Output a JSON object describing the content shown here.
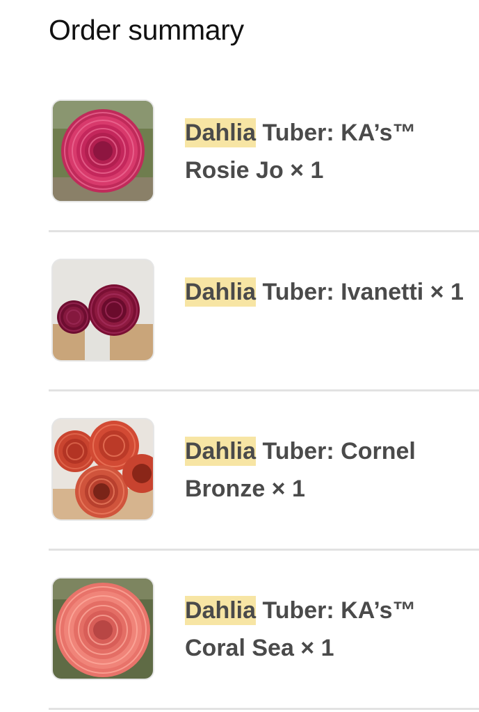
{
  "header": {
    "title": "Order summary"
  },
  "highlight": {
    "term": "Dahlia",
    "color": "#f7e5a4"
  },
  "items": [
    {
      "highlight": "Dahlia",
      "rest": " Tuber: KA’s™ Rosie Jo",
      "qty": " × 1",
      "image": "dahlia-rosie-jo-photo"
    },
    {
      "highlight": "Dahlia",
      "rest": " Tuber: Ivanetti",
      "qty": " × 1",
      "image": "dahlia-ivanetti-photo"
    },
    {
      "highlight": "Dahlia",
      "rest": " Tuber: Cornel Bronze",
      "qty": " × 1",
      "image": "dahlia-cornel-bronze-photo"
    },
    {
      "highlight": "Dahlia",
      "rest": " Tuber: KA’s™ Coral Sea",
      "qty": " × 1",
      "image": "dahlia-coral-sea-photo"
    }
  ]
}
